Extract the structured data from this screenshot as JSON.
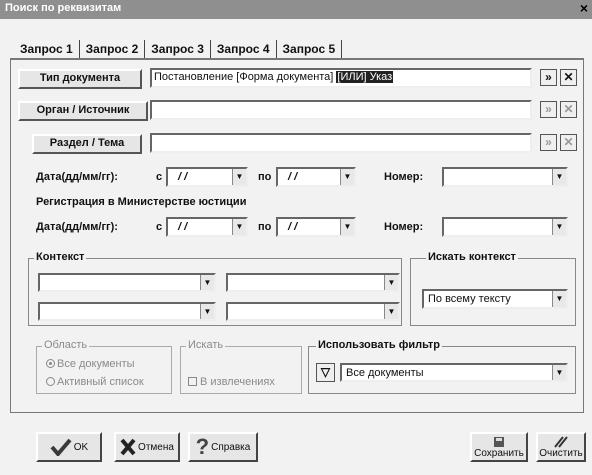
{
  "window": {
    "title": "Поиск по реквизитам",
    "close_glyph": "×"
  },
  "tabs": [
    "Запрос 1",
    "Запрос 2",
    "Запрос 3",
    "Запрос 4",
    "Запрос 5"
  ],
  "doc_type": {
    "button": "Тип документа",
    "value_text": "Постановление [Форма документа] ",
    "value_highlight": "[ИЛИ] Указ"
  },
  "organ": {
    "button": "Орган / Источник",
    "value": ""
  },
  "section": {
    "button": "Раздел / Тема",
    "value": ""
  },
  "dates": {
    "label": "Дата(дд/мм/гг):",
    "from_label": "с",
    "to_label": "по",
    "from_value": "/ /",
    "to_value": "/ /",
    "number_label": "Номер:",
    "number_value": ""
  },
  "registration": {
    "title": "Регистрация в Министерстве юстиции",
    "label": "Дата(дд/мм/гг):",
    "from_label": "с",
    "to_label": "по",
    "from_value": "/ /",
    "to_value": "/ /",
    "number_label": "Номер:",
    "number_value": ""
  },
  "context": {
    "title": "Контекст"
  },
  "search_context": {
    "title": "Искать контекст",
    "value": "По всему тексту"
  },
  "area": {
    "title": "Область",
    "options": [
      "Все документы",
      "Активный список"
    ],
    "selected": 0
  },
  "search_in": {
    "title": "Искать",
    "checkbox": "В извлечениях"
  },
  "filter": {
    "title": "Использовать фильтр",
    "value": "Все документы"
  },
  "buttons": {
    "ok": "OK",
    "cancel": "Отмена",
    "help": "Справка",
    "save": "Сохранить",
    "clear": "Очистить"
  },
  "colors": {
    "highlight_bg": "#222222",
    "ok_check": "#3a3a3a"
  },
  "icons": {
    "add": "double-chevron-right-icon",
    "remove": "x-icon",
    "filter": "funnel-icon"
  }
}
